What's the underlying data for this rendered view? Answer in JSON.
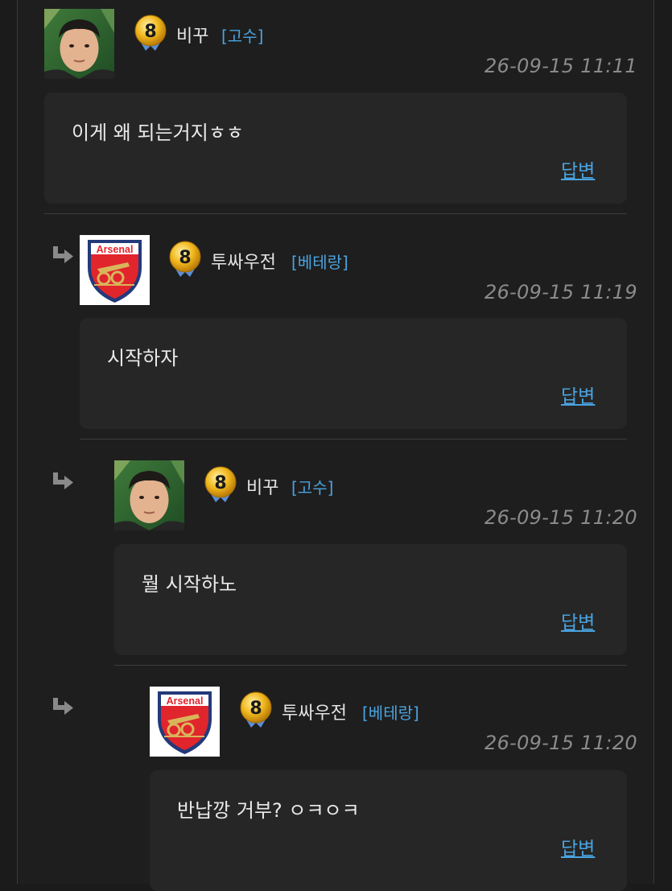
{
  "comments": [
    {
      "author": "비꾸",
      "rank": "[고수]",
      "level": "8",
      "avatar": "face-avatar",
      "timestamp": "26-09-15 11:11",
      "text": "이게 왜 되는거지ㅎㅎ",
      "reply_label": "답변",
      "is_reply": false
    },
    {
      "author": "투싸우전",
      "rank": "[베테랑]",
      "level": "8",
      "avatar": "arsenal-crest",
      "timestamp": "26-09-15 11:19",
      "text": "시작하자",
      "reply_label": "답변",
      "is_reply": true
    },
    {
      "author": "비꾸",
      "rank": "[고수]",
      "level": "8",
      "avatar": "face-avatar",
      "timestamp": "26-09-15 11:20",
      "text": "뭘 시작하노",
      "reply_label": "답변",
      "is_reply": true
    },
    {
      "author": "투싸우전",
      "rank": "[베테랑]",
      "level": "8",
      "avatar": "arsenal-crest",
      "timestamp": "26-09-15 11:20",
      "text": "반납깡 거부?  ㅇㅋㅇㅋ",
      "reply_label": "답변",
      "is_reply": true
    }
  ],
  "crest_text": "Arsenal",
  "icons": {
    "reply_arrow": "reply-arrow-icon",
    "level_badge": "level-badge-icon"
  },
  "colors": {
    "background": "#1e1e1e",
    "card": "#262626",
    "rank": "#4aa3df",
    "timestamp": "#8b8b8b",
    "text": "#eaeaea"
  }
}
